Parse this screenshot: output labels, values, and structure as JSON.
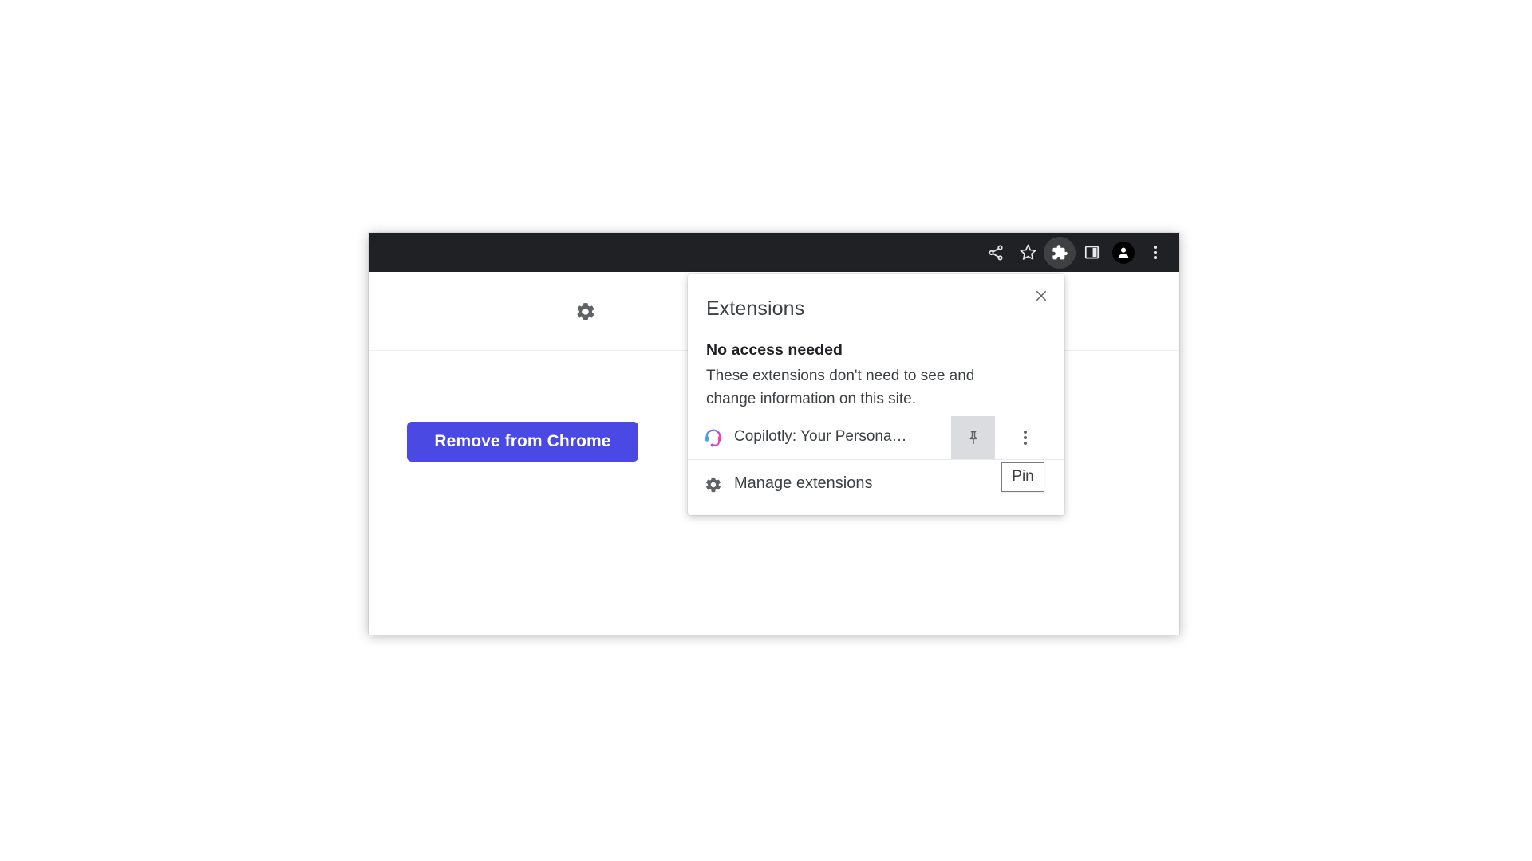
{
  "browser": {
    "toolbar": {
      "buttons": [
        {
          "name": "share-icon",
          "label": "Share"
        },
        {
          "name": "bookmark-star-icon",
          "label": "Bookmark this tab"
        },
        {
          "name": "extensions-puzzle-icon",
          "label": "Extensions",
          "active": true
        },
        {
          "name": "side-panel-icon",
          "label": "Show side panel"
        },
        {
          "name": "profile-avatar-icon",
          "label": "Profile"
        },
        {
          "name": "chrome-menu-kebab-icon",
          "label": "Customize and control Google Chrome"
        }
      ]
    }
  },
  "page": {
    "gear_icon": "gear-icon",
    "remove_button_label": "Remove from Chrome",
    "accent_color": "#4A49E4"
  },
  "extensions_popup": {
    "title": "Extensions",
    "close_label": "Close",
    "section": {
      "heading": "No access needed",
      "description": "These extensions don't need to see and change information on this site."
    },
    "items": [
      {
        "icon": "copilotly-headset-icon",
        "name": "Copilotly: Your Persona…",
        "pin_icon": "pin-icon",
        "more_icon": "kebab-menu-icon"
      }
    ],
    "manage": {
      "icon": "gear-icon",
      "label": "Manage extensions"
    }
  },
  "tooltip": {
    "text": "Pin"
  }
}
